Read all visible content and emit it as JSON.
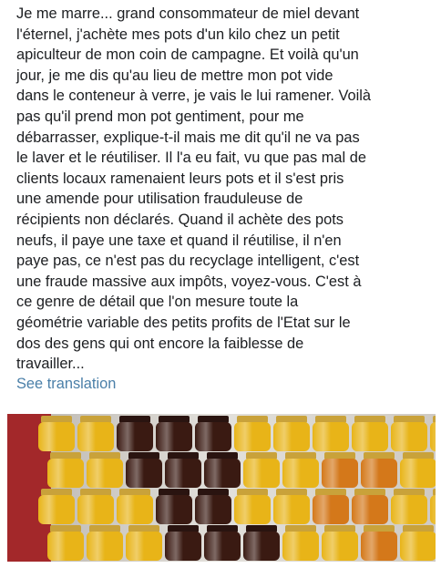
{
  "post": {
    "text_lines": [
      "Je me marre... grand consommateur de miel devant",
      "l'éternel, j'achète mes pots d'un kilo chez un petit",
      "apiculteur de mon coin de campagne. Et voilà qu'un",
      "jour, je me dis qu'au lieu de mettre mon pot vide",
      "dans le conteneur à verre, je vais le lui ramener. Voilà",
      "pas qu'il prend mon pot gentiment, pour me",
      "débarrasser, explique-t-il mais me dit qu'il ne va pas",
      "le laver et le réutiliser. Il l'a eu fait, vu que pas mal de",
      "clients locaux ramenaient leurs pots et il s'est pris",
      "une amende pour utilisation frauduleuse de",
      "récipients non déclarés. Quand il achète des pots",
      "neufs, il paye une taxe et quand il réutilise, il n'en",
      "paye pas, ce n'est pas du recyclage intelligent, c'est",
      "une fraude massive aux impôts, voyez-vous. C'est à",
      "ce genre de détail que l'on mesure toute la",
      "géométrie variable des petits profits de l'Etat sur le",
      "dos des gens qui ont encore la faiblesse de",
      "travailler..."
    ],
    "see_translation": "See translation"
  },
  "photo": {
    "subject": "honey-jars-stack",
    "colors": {
      "light_honey": "#e8b418",
      "amber_honey": "#d4781a",
      "dark_honey": "#3a1a12",
      "lid_gold": "#c9a23a",
      "lid_dark": "#2a1410",
      "background": "#d9d9d6",
      "left_edge": "#a3282a"
    }
  }
}
